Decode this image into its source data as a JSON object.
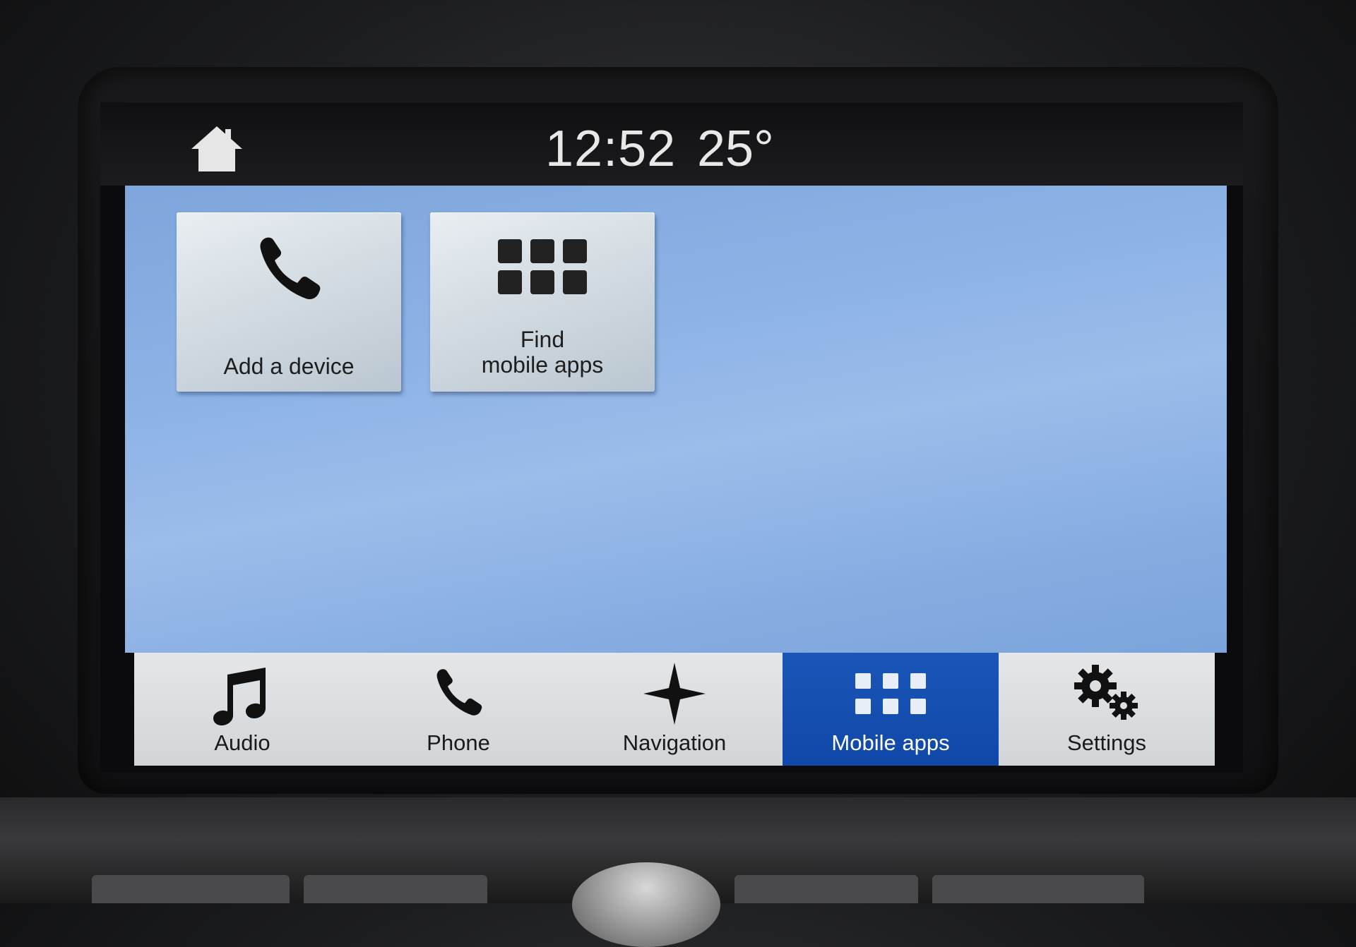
{
  "status_bar": {
    "time": "12:52",
    "temperature": "25°"
  },
  "tiles": [
    {
      "label": "Add a device",
      "icon": "phone-icon"
    },
    {
      "label_line1": "Find",
      "label_line2": "mobile apps",
      "icon": "apps-grid-icon"
    }
  ],
  "nav": {
    "items": [
      {
        "label": "Audio",
        "icon": "music-note-icon",
        "active": false
      },
      {
        "label": "Phone",
        "icon": "phone-icon",
        "active": false
      },
      {
        "label": "Navigation",
        "icon": "compass-star-icon",
        "active": false
      },
      {
        "label": "Mobile apps",
        "icon": "apps-grid-icon",
        "active": true
      },
      {
        "label": "Settings",
        "icon": "gears-icon",
        "active": false
      }
    ],
    "active_color": "#1450b0"
  },
  "colors": {
    "background_blue": "#8db3e6",
    "status_bar": "#151517",
    "text_light": "#e8e8e8"
  }
}
